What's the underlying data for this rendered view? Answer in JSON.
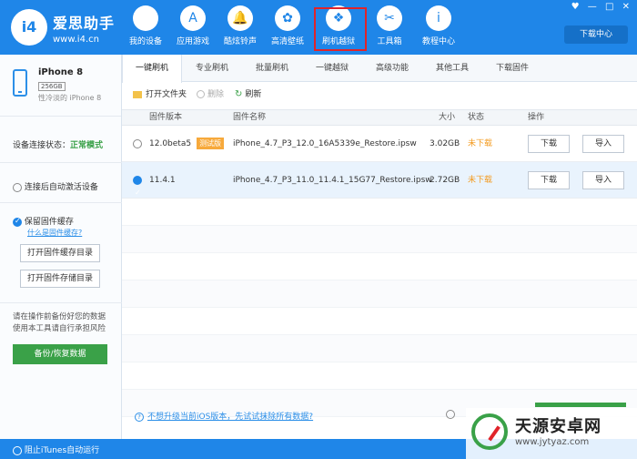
{
  "header": {
    "logo_text": "i4",
    "brand_name": "爱思助手",
    "brand_url": "www.i4.cn",
    "window_controls": [
      "♥",
      "—",
      "□",
      "✕"
    ],
    "download_center": "下载中心"
  },
  "nav": [
    {
      "icon": "apple-icon",
      "glyph": "",
      "label": "我的设备"
    },
    {
      "icon": "appstore-icon",
      "glyph": "A",
      "label": "应用游戏"
    },
    {
      "icon": "bell-icon",
      "glyph": "🔔",
      "label": "酷炫铃声"
    },
    {
      "icon": "flower-icon",
      "glyph": "✿",
      "label": "高清壁纸"
    },
    {
      "icon": "dropbox-icon",
      "glyph": "❖",
      "label": "刷机越狱"
    },
    {
      "icon": "tools-icon",
      "glyph": "✂",
      "label": "工具箱"
    },
    {
      "icon": "info-icon",
      "glyph": "i",
      "label": "教程中心"
    }
  ],
  "sidebar": {
    "device_name": "iPhone 8",
    "storage": "256GB",
    "device_sub": "性冷淡的 iPhone 8",
    "conn_label": "设备连接状态：",
    "conn_value": "正常模式",
    "auto_activate": "连接后自动激活设备",
    "keep_cache": "保留固件缓存",
    "cache_link": "什么是固件缓存?",
    "open_cache_dir": "打开固件缓存目录",
    "open_store_dir": "打开固件存储目录",
    "warning": "请在操作前备份好您的数据使用本工具请自行承担风险",
    "backup": "备份/恢复数据"
  },
  "tabs": [
    "一键刷机",
    "专业刷机",
    "批量刷机",
    "一键越狱",
    "高级功能",
    "其他工具",
    "下载固件"
  ],
  "toolbar": {
    "open_folder": "打开文件夹",
    "delete": "删除",
    "refresh": "刷新"
  },
  "table": {
    "headers": {
      "version": "固件版本",
      "name": "固件名称",
      "size": "大小",
      "status": "状态",
      "action": "操作"
    },
    "rows": [
      {
        "version": "12.0beta5",
        "badge": "测试版",
        "name": "iPhone_4.7_P3_12.0_16A5339e_Restore.ipsw",
        "size": "3.02GB",
        "status": "未下载",
        "download": "下载",
        "import": "导入",
        "selected": false
      },
      {
        "version": "11.4.1",
        "badge": "",
        "name": "iPhone_4.7_P3_11.0_11.4.1_15G77_Restore.ipsw",
        "size": "2.72GB",
        "status": "未下载",
        "download": "下载",
        "import": "导入",
        "selected": true
      }
    ]
  },
  "bottom": {
    "info_link": "不想升级当前iOS版本，先试试抹除所有数据?"
  },
  "statusbar": {
    "option": "阻止iTunes自动运行"
  },
  "watermark": {
    "title": "天源安卓网",
    "url": "www.jytyaz.com"
  }
}
